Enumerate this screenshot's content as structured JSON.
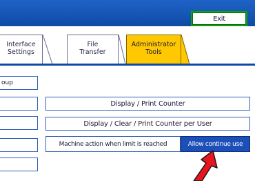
{
  "header": {
    "exit_label": "Exit"
  },
  "tabs": [
    {
      "line1": "Interface",
      "line2": "Settings"
    },
    {
      "line1": "File",
      "line2": "Transfer"
    },
    {
      "line1": "Administrator",
      "line2": "Tools"
    }
  ],
  "left_items": [
    "oup",
    "",
    "",
    "",
    ""
  ],
  "rows": {
    "display_print_counter": "Display / Print Counter",
    "display_clear_print_counter_per_user": "Display / Clear / Print Counter per User",
    "machine_action_label": "Machine action when limit is reached",
    "machine_action_value": "Allow continue use"
  },
  "colors": {
    "title_bar": "#0e4aa5",
    "active_tab": "#ffc800",
    "selected_value": "#1d4fb8",
    "exit_border": "#14a014",
    "pointer_arrow": "#e8141e"
  }
}
